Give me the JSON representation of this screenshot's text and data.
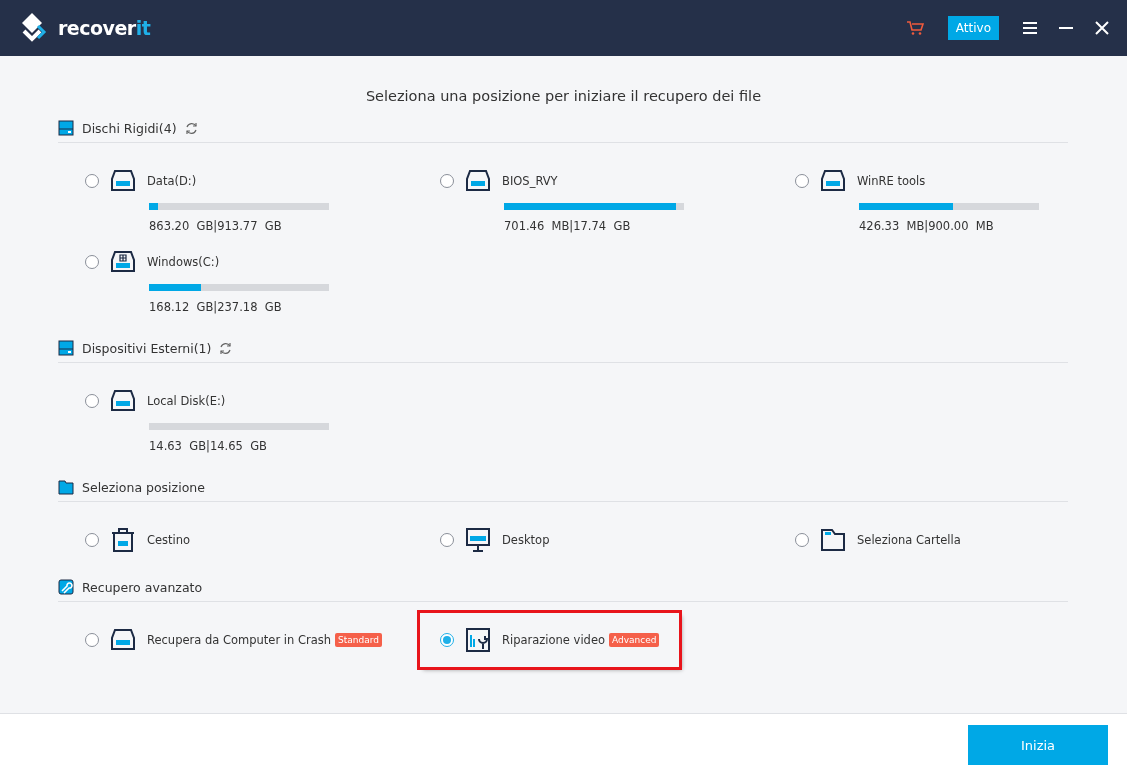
{
  "header": {
    "logo": {
      "text": "recover",
      "accent": "it"
    },
    "buttons": [
      {
        "kind": "cart"
      },
      {
        "kind": "label",
        "label": "Attivo"
      },
      {
        "kind": "menu"
      },
      {
        "kind": "minimize"
      },
      {
        "kind": "close"
      }
    ]
  },
  "title": "Seleziona una posizione per iniziare il recupero dei file",
  "sections": [
    {
      "title": "Dischi Rigidi(4)",
      "kind": "drives",
      "items": [
        {
          "kind": "drive",
          "label": "Data(D:)",
          "level": 0.05,
          "size": "863.20  GB|913.77  GB",
          "selected": false
        },
        {
          "kind": "drive",
          "label": "BIOS_RVY",
          "level": 0.955,
          "size": "701.46  MB|17.74  GB",
          "selected": false
        },
        {
          "kind": "drive",
          "label": "WinRE tools",
          "level": 0.52,
          "size": "426.33  MB|900.00  MB",
          "selected": false
        },
        {
          "kind": "windows",
          "label": "Windows(C:)",
          "level": 0.29,
          "size": "168.12  GB|237.18  GB",
          "selected": false
        }
      ]
    },
    {
      "title": "Dispositivi Esterni(1)",
      "kind": "drives",
      "items": [
        {
          "kind": "drive",
          "label": "Local Disk(E:)",
          "level": 0,
          "size": "14.63  GB|14.65  GB",
          "selected": false
        }
      ]
    },
    {
      "title": "Seleziona posizione",
      "kind": "locations",
      "items": [
        {
          "kind": "trash",
          "label": "Cestino",
          "selected": false
        },
        {
          "kind": "monitor",
          "label": "Desktop",
          "selected": false
        },
        {
          "kind": "folder",
          "label": "Seleziona Cartella",
          "selected": false
        }
      ]
    },
    {
      "title": "Recupero avanzato",
      "kind": "advanced",
      "items": [
        {
          "kind": "drive",
          "label": "Recupera da Computer in Crash",
          "badge": "Standard",
          "selected": false
        },
        {
          "kind": "repair",
          "label": "Riparazione video",
          "badge": "Advanced",
          "selected": true
        }
      ]
    }
  ],
  "footer": {
    "button": "Inizia"
  }
}
